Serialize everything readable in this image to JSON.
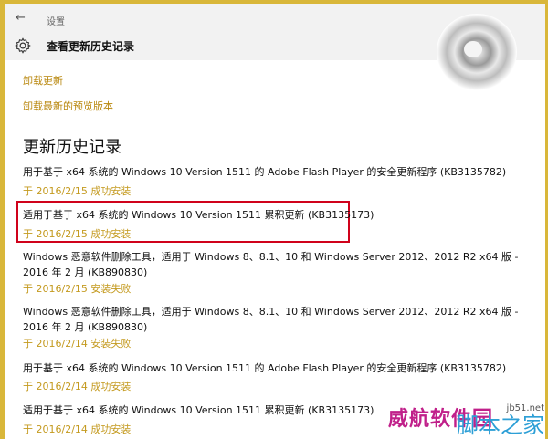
{
  "window": {
    "app_title": "设置",
    "page_title": "查看更新历史记录"
  },
  "links": {
    "uninstall": "卸载更新",
    "uninstall_preview": "卸载最新的预览版本"
  },
  "section_heading": "更新历史记录",
  "updates": [
    {
      "title": "用于基于 x64 系统的 Windows 10 Version 1511 的 Adobe Flash Player 的安全更新程序 (KB3135782)",
      "status": "于 2016/2/15 成功安装"
    },
    {
      "title": "适用于基于 x64 系统的 Windows 10 Version 1511 累积更新 (KB3135173)",
      "status": "于 2016/2/15 成功安装"
    },
    {
      "title": "Windows 恶意软件删除工具，适用于 Windows 8、8.1、10 和 Windows Server 2012、2012 R2 x64 版 - 2016 年 2 月 (KB890830)",
      "status": "于 2016/2/15 安装失败"
    },
    {
      "title": "Windows 恶意软件删除工具，适用于 Windows 8、8.1、10 和 Windows Server 2012、2012 R2 x64 版 - 2016 年 2 月 (KB890830)",
      "status": "于 2016/2/14 安装失败"
    },
    {
      "title": "用于基于 x64 系统的 Windows 10 Version 1511 的 Adobe Flash Player 的安全更新程序 (KB3135782)",
      "status": "于 2016/2/14 成功安装"
    },
    {
      "title": "适用于基于 x64 系统的 Windows 10 Version 1511 累积更新 (KB3135173)",
      "status": "于 2016/2/14 成功安装"
    }
  ],
  "watermark": {
    "text": "威航软件园",
    "sub": "脚本之家",
    "url": "jb51.net"
  },
  "colors": {
    "accent_link": "#b8860b",
    "status_text": "#c49a1f",
    "highlight": "#d0021b",
    "frame": "#d9b73a"
  }
}
